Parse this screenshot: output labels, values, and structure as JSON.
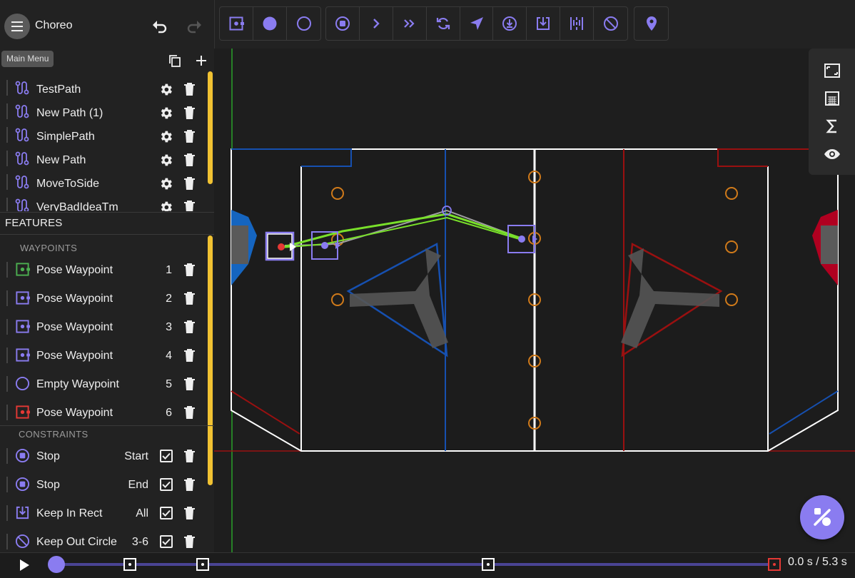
{
  "app": {
    "title": "Choreo",
    "tooltip": "Main Menu"
  },
  "paths": [
    {
      "label": "TestPath"
    },
    {
      "label": "New Path (1)"
    },
    {
      "label": "SimplePath"
    },
    {
      "label": "New Path"
    },
    {
      "label": "MoveToSide"
    },
    {
      "label": "VeryBadIdeaTm"
    }
  ],
  "features": {
    "header": "FEATURES",
    "waypoints_header": "WAYPOINTS",
    "waypoints": [
      {
        "label": "Pose Waypoint",
        "num": "1",
        "color": "#4caf50"
      },
      {
        "label": "Pose Waypoint",
        "num": "2",
        "color": "#8a7cf0"
      },
      {
        "label": "Pose Waypoint",
        "num": "3",
        "color": "#8a7cf0"
      },
      {
        "label": "Pose Waypoint",
        "num": "4",
        "color": "#8a7cf0"
      },
      {
        "label": "Empty Waypoint",
        "num": "5",
        "color": "#8a7cf0"
      },
      {
        "label": "Pose Waypoint",
        "num": "6",
        "color": "#e53935"
      }
    ],
    "constraints_header": "CONSTRAINTS",
    "constraints": [
      {
        "label": "Stop",
        "scope": "Start",
        "icon": "stop-point-icon"
      },
      {
        "label": "Stop",
        "scope": "End",
        "icon": "stop-point-icon"
      },
      {
        "label": "Keep In Rect",
        "scope": "All",
        "icon": "keep-in-rect-icon"
      },
      {
        "label": "Keep Out Circle",
        "scope": "3-6",
        "icon": "keep-out-circle-icon"
      }
    ]
  },
  "toolbar": {
    "groups": [
      [
        "pose-waypoint-icon",
        "translation-waypoint-icon",
        "empty-waypoint-icon"
      ],
      [
        "stop-point-icon",
        "max-velocity-icon",
        "max-acceleration-icon",
        "point-at-icon",
        "straight-line-icon",
        "keep-in-circle-icon",
        "keep-in-rect-icon",
        "keep-in-lane-icon",
        "keep-out-circle-icon"
      ],
      [
        "event-marker-icon"
      ]
    ]
  },
  "view_panel": [
    "fit-view-icon",
    "grid-icon",
    "sigma-icon",
    "visibility-eye-icon"
  ],
  "timeline": {
    "time": "0.0 s / 5.3 s",
    "progress": 0.0
  },
  "colors": {
    "accent": "#8a7cf0",
    "start": "#4caf50",
    "end": "#e53935",
    "scrollbar": "#f1c232"
  }
}
